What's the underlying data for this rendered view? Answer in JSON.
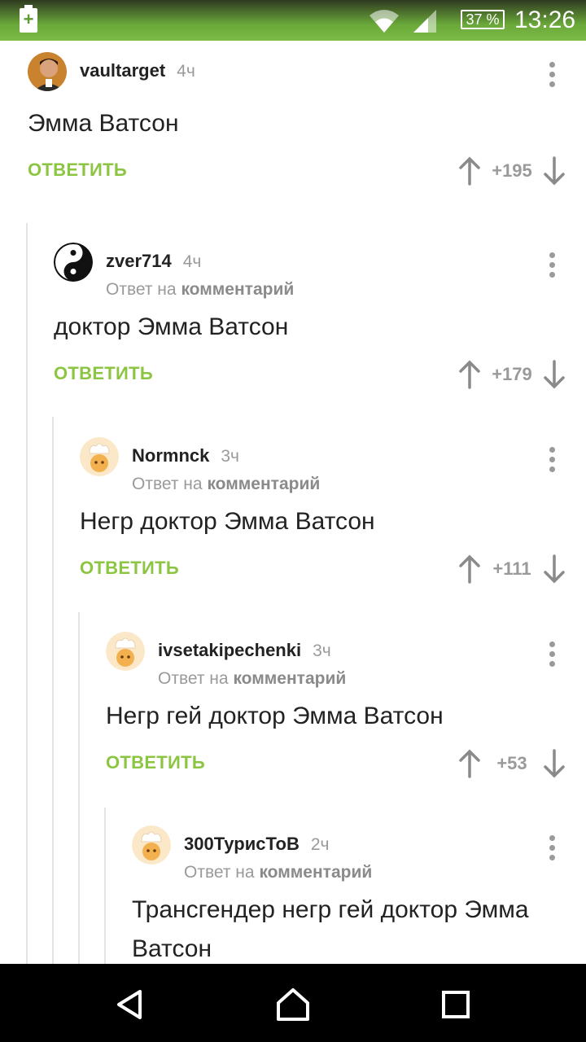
{
  "status": {
    "battery_percent": "37 %",
    "time": "13:26",
    "charging_icon": "plus"
  },
  "comments": [
    {
      "author": "vaultarget",
      "time": "4ч",
      "reply_prefix": "",
      "reply_link": "",
      "text": "Эмма Ватсон",
      "reply_label": "ОТВЕТИТЬ",
      "score": "+195",
      "avatar": "photo"
    },
    {
      "author": "zver714",
      "time": "4ч",
      "reply_prefix": "Ответ на",
      "reply_link": "комментарий",
      "text": "доктор Эмма Ватсон",
      "reply_label": "ОТВЕТИТЬ",
      "score": "+179",
      "avatar": "yin-yang"
    },
    {
      "author": "Normnck",
      "time": "3ч",
      "reply_prefix": "Ответ на",
      "reply_link": "комментарий",
      "text": "Негр доктор Эмма Ватсон",
      "reply_label": "ОТВЕТИТЬ",
      "score": "+111",
      "avatar": "chef"
    },
    {
      "author": "ivsetakipechenki",
      "time": "3ч",
      "reply_prefix": "Ответ на",
      "reply_link": "комментарий",
      "text": "Негр гей доктор Эмма Ватсон",
      "reply_label": "ОТВЕТИТЬ",
      "score": "+53",
      "avatar": "chef"
    },
    {
      "author": "300ТурисТоВ",
      "time": "2ч",
      "reply_prefix": "Ответ на",
      "reply_link": "комментарий",
      "text": "Трансгендер негр гей доктор Эмма Ватсон",
      "reply_label": "",
      "score": "",
      "avatar": "chef"
    }
  ],
  "colors": {
    "accent": "#8cc542",
    "muted": "#9a9a9a",
    "statusbar": "#7cbb45"
  }
}
